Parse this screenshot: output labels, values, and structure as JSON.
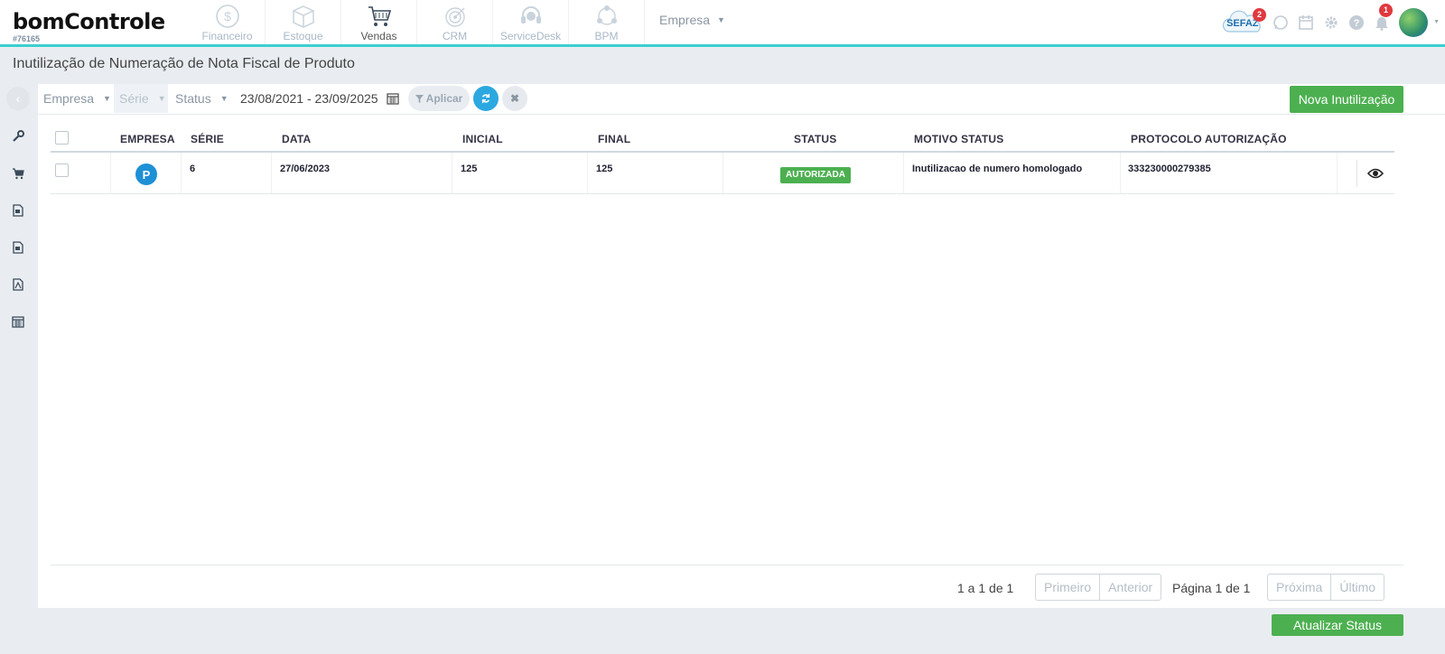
{
  "brand": {
    "logo_text": "bomControle",
    "account_id": "#76165"
  },
  "nav": {
    "modules": [
      {
        "label": "Financeiro",
        "icon": "dollar-coin-icon"
      },
      {
        "label": "Estoque",
        "icon": "box-icon"
      },
      {
        "label": "Vendas",
        "icon": "shopping-cart-icon",
        "active": true
      },
      {
        "label": "CRM",
        "icon": "target-icon"
      },
      {
        "label": "ServiceDesk",
        "icon": "headset-icon"
      },
      {
        "label": "BPM",
        "icon": "workflow-icon"
      }
    ],
    "empresa_label": "Empresa",
    "sefaz_label": "SEFAZ",
    "sefaz_badge": "2",
    "notifications_badge": "1"
  },
  "page": {
    "title": "Inutilização de Numeração de Nota Fiscal de Produto"
  },
  "filters": {
    "empresa": "Empresa",
    "serie": "Série",
    "status": "Status",
    "date_range": "23/08/2021 - 23/09/2025",
    "apply_label": "Aplicar",
    "new_button": "Nova Inutilização"
  },
  "table": {
    "headers": {
      "empresa": "EMPRESA",
      "serie": "SÉRIE",
      "data": "DATA",
      "inicial": "INICIAL",
      "final": "FINAL",
      "status": "STATUS",
      "motivo": "MOTIVO STATUS",
      "protocolo": "PROTOCOLO AUTORIZAÇÃO"
    },
    "rows": [
      {
        "empresa_initial": "P",
        "serie": "6",
        "data": "27/06/2023",
        "inicial": "125",
        "final": "125",
        "status": "AUTORIZADA",
        "motivo": "Inutilizacao de numero homologado",
        "protocolo": "333230000279385"
      }
    ]
  },
  "pagination": {
    "count_text": "1 a 1 de 1",
    "first": "Primeiro",
    "previous": "Anterior",
    "page_text": "Página 1 de 1",
    "next": "Próxima",
    "last": "Último"
  },
  "footer": {
    "update_status_button": "Atualizar Status"
  },
  "colors": {
    "accent": "#3ccfcf",
    "primary_green": "#4cb050",
    "primary_blue": "#2ca8e0"
  }
}
